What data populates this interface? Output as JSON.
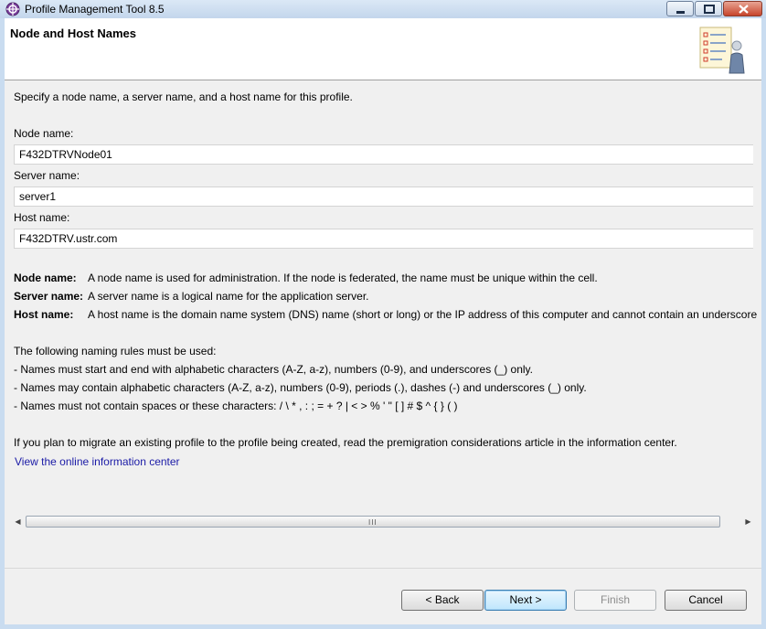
{
  "window": {
    "title": "Profile Management Tool 8.5"
  },
  "header": {
    "title": "Node and Host Names"
  },
  "intro": "Specify a node name, a server name, and a host name for this profile.",
  "fields": {
    "node": {
      "label": "Node name:",
      "value": "F432DTRVNode01"
    },
    "server": {
      "label": "Server name:",
      "value": "server1"
    },
    "host": {
      "label": "Host name:",
      "value": "F432DTRV.ustr.com"
    }
  },
  "descriptions": [
    {
      "key": "Node name:",
      "text": "A node name is used for administration. If the node is federated, the name must be unique within the cell."
    },
    {
      "key": "Server name:",
      "text": "A server name is a logical name for the application server."
    },
    {
      "key": "Host name:",
      "text": "A host name is the domain name system (DNS) name (short or long) or the IP address of this computer and cannot contain an underscore"
    }
  ],
  "rules": {
    "heading": "The following naming rules must be used:",
    "items": [
      "- Names must start and end with alphabetic characters (A-Z, a-z), numbers (0-9), and underscores (_) only.",
      "- Names may contain alphabetic characters (A-Z, a-z), numbers (0-9), periods (.), dashes (-) and underscores (_) only.",
      "- Names must not contain spaces or these characters: / \\ * , : ; = + ? | < >  % ' \" [ ] # $ ^ { } ( )"
    ]
  },
  "migration_note": "If you plan to migrate an existing profile to the profile being created, read the premigration considerations article in the information center.",
  "info_link": "View the online information center",
  "scrollbar": {
    "grip": "III"
  },
  "buttons": {
    "back": "< Back",
    "next": "Next >",
    "finish": "Finish",
    "cancel": "Cancel"
  },
  "icons": {
    "app": "profile-tool-icon",
    "wizard": "checklist-person-icon"
  }
}
